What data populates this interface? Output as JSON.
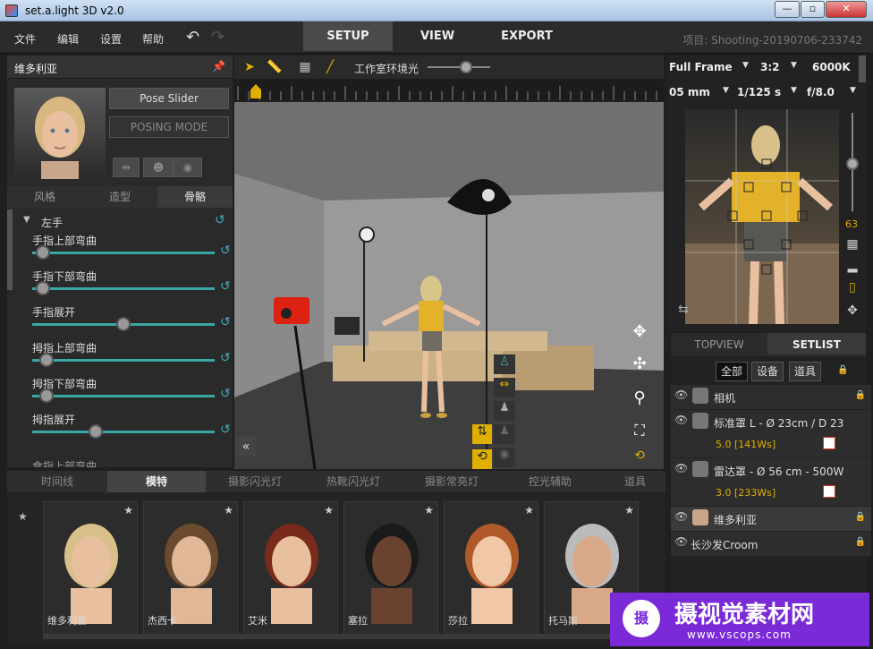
{
  "window": {
    "title": "set.a.light 3D v2.0",
    "min": "—",
    "max": "▫",
    "close": "✕"
  },
  "menu": {
    "file": "文件",
    "edit": "编辑",
    "settings": "设置",
    "help": "帮助",
    "undo": "↶",
    "redo": "↷"
  },
  "main_tabs": [
    "SETUP",
    "VIEW",
    "EXPORT"
  ],
  "project": "项目: Shooting-20190706-233742",
  "left": {
    "model_name": "维多利亚",
    "pose_slider": "Pose Slider",
    "posing_mode": "POSING MODE",
    "sub_tabs": [
      "风格",
      "造型",
      "骨骼"
    ],
    "section": "左手",
    "sliders": [
      {
        "label": "手指上部弯曲",
        "value": 0.06
      },
      {
        "label": "手指下部弯曲",
        "value": 0.06
      },
      {
        "label": "手指展开",
        "value": 0.5
      },
      {
        "label": "拇指上部弯曲",
        "value": 0.08
      },
      {
        "label": "拇指下部弯曲",
        "value": 0.08
      },
      {
        "label": "拇指展开",
        "value": 0.35
      }
    ],
    "cut_label": "食指上部弯曲"
  },
  "viewport": {
    "env_label": "工作室环境光",
    "env_value": 0.6
  },
  "right": {
    "frame": "Full Frame",
    "ratio": "3:2",
    "kelvin": "6000K",
    "focal": "05 mm",
    "shutter": "1/125 s",
    "aperture": "f/8.0",
    "side_value": "63",
    "tabs": [
      "TOPVIEW",
      "SETLIST"
    ],
    "filters": [
      "全部",
      "设备",
      "道具"
    ],
    "setlist": [
      {
        "name": "相机"
      },
      {
        "name": "标准罩 L - Ø 23cm / D 23",
        "power": "5.0 [141Ws]"
      },
      {
        "name": "雷达罩 - Ø 56 cm - 500W",
        "power": "3.0 [233Ws]"
      },
      {
        "name": "维多利亚"
      },
      {
        "name": "长沙发Croom"
      }
    ]
  },
  "bottom": {
    "tabs": [
      "时间线",
      "模特",
      "摄影闪光灯",
      "热靴闪光灯",
      "摄影常亮灯",
      "控光辅助",
      "道具"
    ],
    "models": [
      "维多利亚",
      "杰西卡",
      "艾米",
      "塞拉",
      "莎拉",
      "托马斯"
    ]
  },
  "watermark": {
    "title": "摄视觉素材网",
    "url": "www.vscops.com"
  },
  "colors": {
    "accent": "#3aa7a4",
    "gold": "#e0b000",
    "red": "#d32",
    "bg": "#2a2a2a"
  }
}
